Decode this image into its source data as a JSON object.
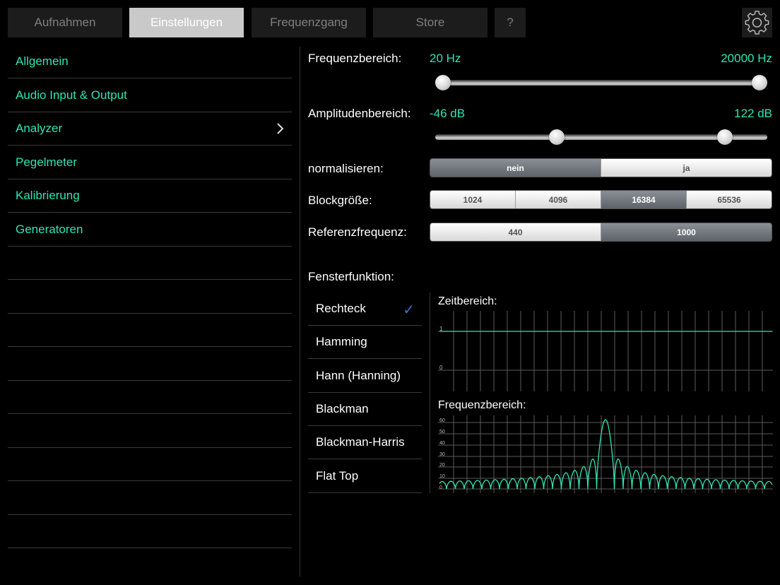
{
  "tabs": [
    {
      "label": "Aufnahmen",
      "active": false
    },
    {
      "label": "Einstellungen",
      "active": true
    },
    {
      "label": "Frequenzgang",
      "active": false
    },
    {
      "label": "Store",
      "active": false
    },
    {
      "label": "?",
      "active": false
    }
  ],
  "settings_icon": "gear-icon",
  "sidebar": {
    "items": [
      {
        "label": "Allgemein",
        "chevron": false
      },
      {
        "label": "Audio Input & Output",
        "chevron": false
      },
      {
        "label": "Analyzer",
        "chevron": true
      },
      {
        "label": "Pegelmeter",
        "chevron": false
      },
      {
        "label": "Kalibrierung",
        "chevron": false
      },
      {
        "label": "Generatoren",
        "chevron": false
      }
    ]
  },
  "frequency_range": {
    "label": "Frequenzbereich:",
    "min_label": "20 Hz",
    "max_label": "20000 Hz",
    "low_fraction": 0.0,
    "high_fraction": 1.0
  },
  "amplitude_range": {
    "label": "Amplitudenbereich:",
    "min_label": "-46 dB",
    "max_label": "122 dB",
    "low_fraction": 0.36,
    "high_fraction": 0.89
  },
  "normalize": {
    "label": "normalisieren:",
    "options": [
      "nein",
      "ja"
    ],
    "selected": "nein"
  },
  "block_size": {
    "label": "Blockgröße:",
    "options": [
      "1024",
      "4096",
      "16384",
      "65536"
    ],
    "selected": "16384"
  },
  "reference_frequency": {
    "label": "Referenzfrequenz:",
    "options": [
      "440",
      "1000"
    ],
    "selected": "1000"
  },
  "window_function": {
    "label": "Fensterfunktion:",
    "items": [
      "Rechteck",
      "Hamming",
      "Hann (Hanning)",
      "Blackman",
      "Blackman-Harris",
      "Flat Top"
    ],
    "selected": "Rechteck"
  },
  "time_graph": {
    "title": "Zeitbereich:",
    "ticks": [
      "1",
      "0"
    ]
  },
  "freq_graph": {
    "title": "Frequenzbereich:",
    "ticks": [
      "60",
      "50",
      "40",
      "30",
      "20",
      "10",
      "0"
    ]
  },
  "colors": {
    "accent": "#2ee5b4",
    "checkmark": "#3d6fd0"
  }
}
